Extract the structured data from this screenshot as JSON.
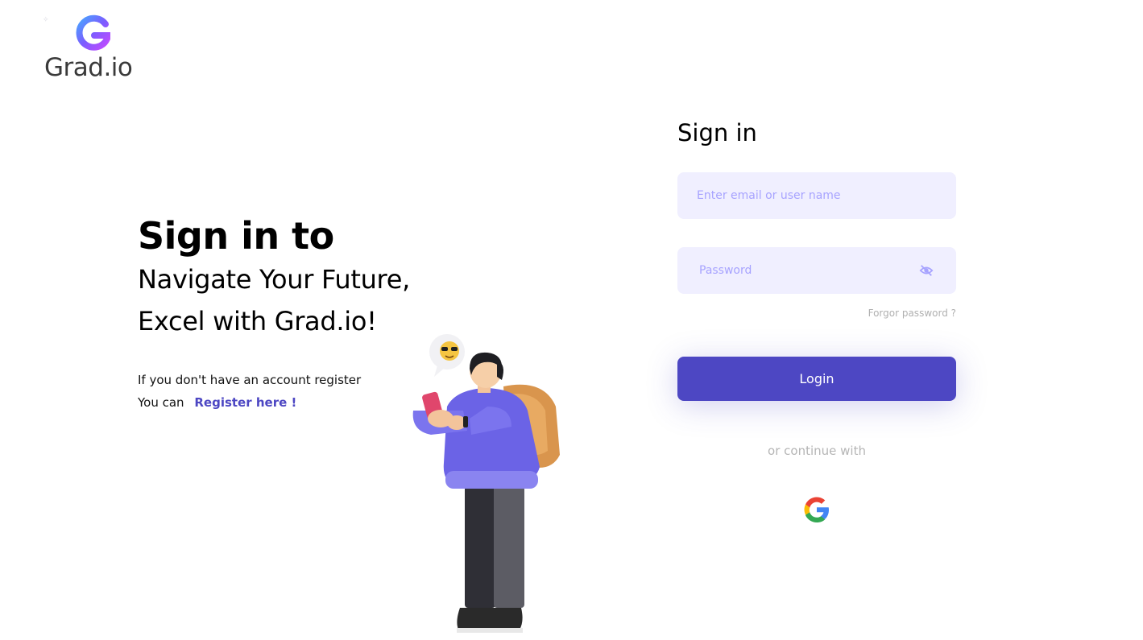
{
  "logo": {
    "letter": "G",
    "name": "Grad.io"
  },
  "hero": {
    "title": "Sign in to",
    "line1": "Navigate Your Future,",
    "line2": "Excel with Grad.io!"
  },
  "register": {
    "line1": "If you don't have an account register",
    "prefix": "You can",
    "link": "Register here !"
  },
  "form": {
    "title": "Sign in",
    "email_placeholder": "Enter email or user name",
    "password_placeholder": "Password",
    "forgot": "Forgor password ?",
    "login": "Login",
    "continue": "or continue with"
  },
  "colors": {
    "accent": "#4d47c3",
    "field_bg": "#f0efff",
    "placeholder": "#a7a3ff"
  },
  "icons": [
    "eye-slash-icon",
    "google-icon"
  ]
}
